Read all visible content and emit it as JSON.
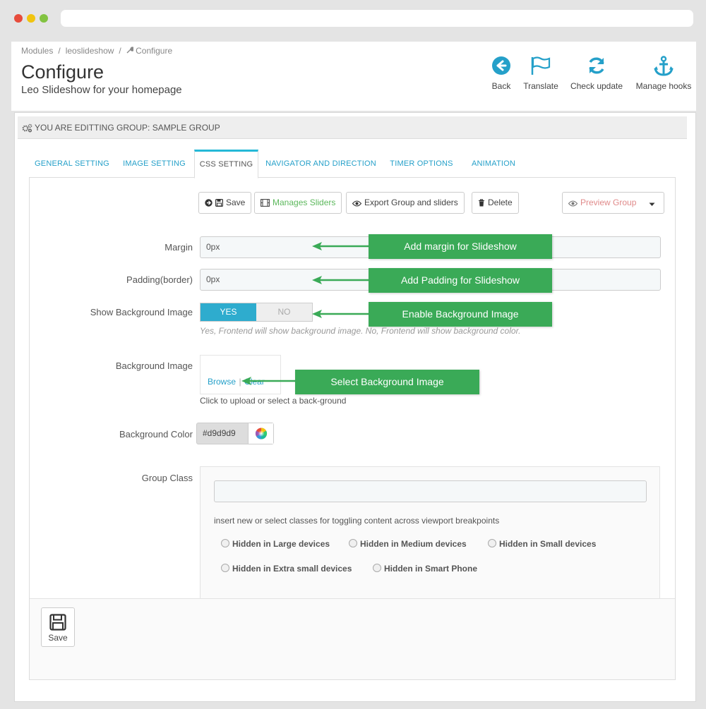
{
  "breadcrumb": {
    "items": [
      "Modules",
      "leoslideshow"
    ],
    "current": "Configure"
  },
  "page": {
    "title": "Configure",
    "subtitle": "Leo Slideshow for your homepage"
  },
  "toolbar": {
    "back": "Back",
    "translate": "Translate",
    "check_update": "Check update",
    "manage_hooks": "Manage hooks"
  },
  "group_bar": "YOU ARE EDITTING GROUP: SAMPLE GROUP",
  "tabs": [
    {
      "label": "GENERAL SETTING",
      "active": false
    },
    {
      "label": "IMAGE SETTING",
      "active": false
    },
    {
      "label": "CSS SETTING",
      "active": true
    },
    {
      "label": "NAVIGATOR AND DIRECTION",
      "active": false
    },
    {
      "label": "TIMER OPTIONS",
      "active": false
    },
    {
      "label": "ANIMATION",
      "active": false
    }
  ],
  "actions": {
    "save": "Save",
    "manages_sliders": "Manages Sliders",
    "export": "Export Group and sliders",
    "delete": "Delete",
    "preview": "Preview Group"
  },
  "form": {
    "margin": {
      "label": "Margin",
      "value": "0px"
    },
    "padding": {
      "label": "Padding(border)",
      "value": "0px"
    },
    "show_bg": {
      "label": "Show Background Image",
      "yes": "YES",
      "no": "NO",
      "selected": "YES",
      "help": "Yes, Frontend will show background image. No, Frontend will show background color."
    },
    "bg_image": {
      "label": "Background Image",
      "browse": "Browse",
      "clear": "Clear",
      "note": "Click to upload or select a back-ground"
    },
    "bg_color": {
      "label": "Background Color",
      "value": "#d9d9d9"
    },
    "group_class": {
      "label": "Group Class",
      "value": "",
      "help": "insert new or select classes for toggling content across viewport breakpoints",
      "options": [
        "Hidden in Large devices",
        "Hidden in Medium devices",
        "Hidden in Small devices",
        "Hidden in Extra small devices",
        "Hidden in Smart Phone"
      ]
    }
  },
  "callouts": {
    "margin": "Add margin for Slideshow",
    "padding": "Add Padding for Slideshow",
    "bg_enable": "Enable Background Image",
    "bg_select": "Select Background Image"
  },
  "footer": {
    "save": "Save"
  },
  "colors": {
    "accent": "#25b9d7",
    "link": "#25a0c9",
    "callout": "#3aaa57",
    "switch_on": "#2eacce",
    "toolbar_icon": "#25a0c9"
  }
}
